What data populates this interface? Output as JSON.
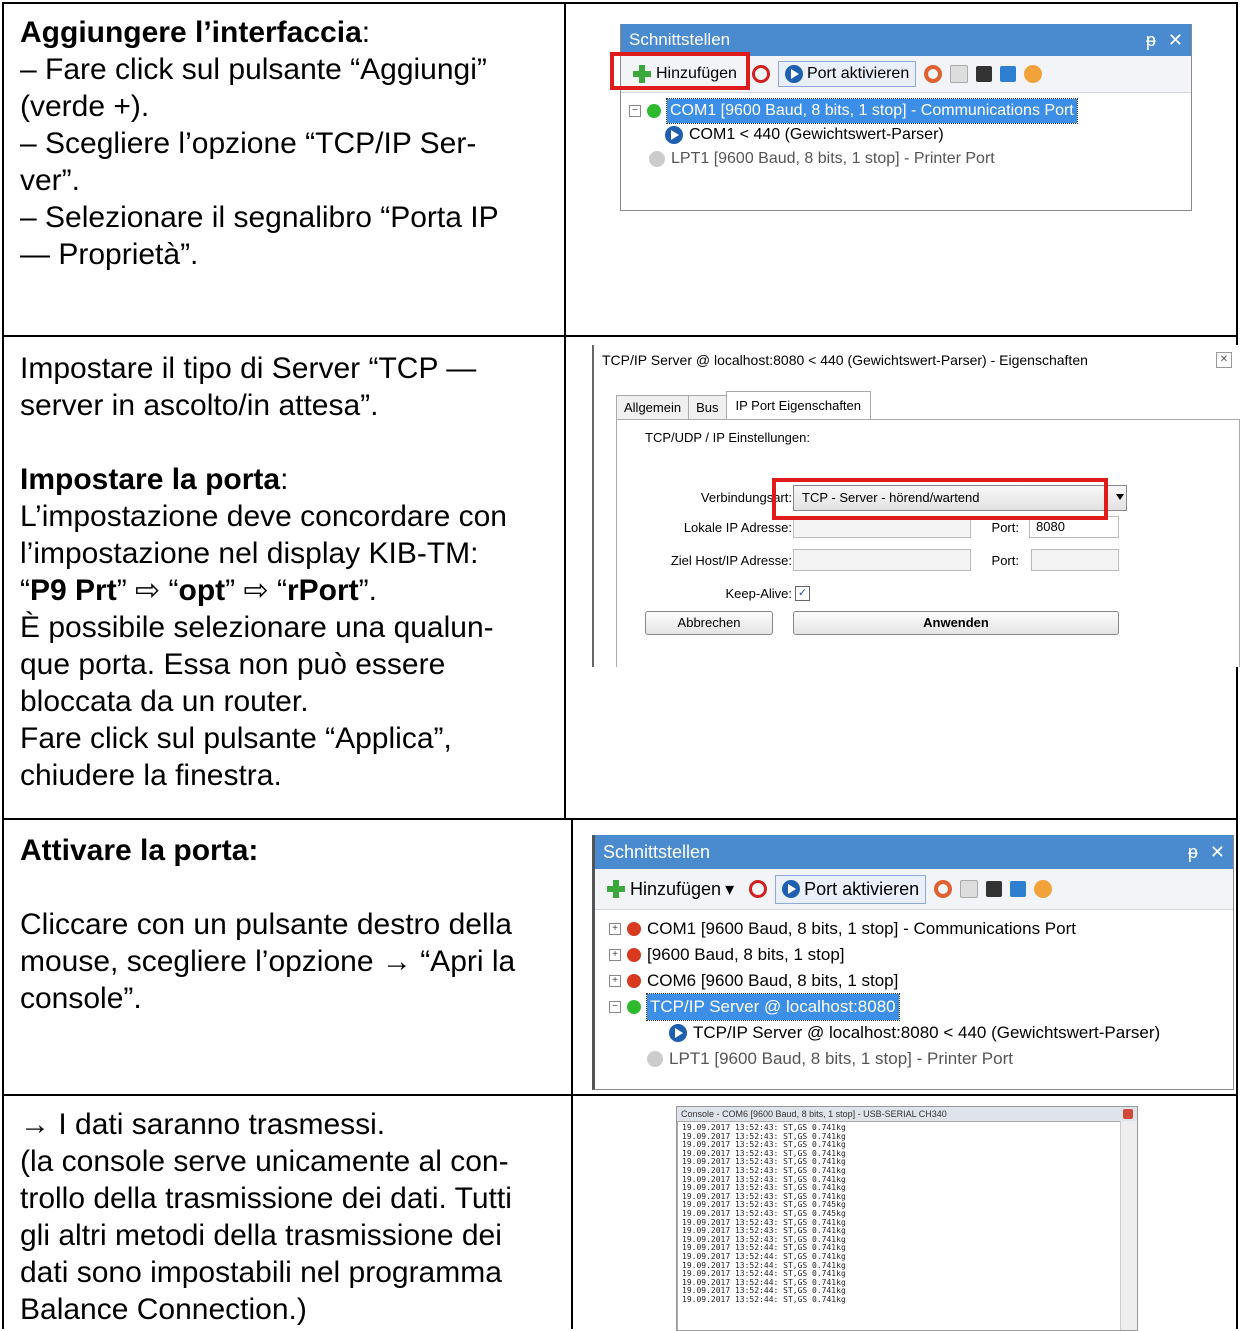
{
  "row1": {
    "heading": "Aggiungere l’interfaccia",
    "heading_suffix": ":",
    "lines": [
      "– Fare click sul pulsante “Aggiungi”",
      "(verde +).",
      "– Scegliere l’opzione “TCP/IP Ser-",
      "ver”.",
      "– Selezionare il segnalibro “Porta IP",
      "— Proprietà”."
    ]
  },
  "row2": {
    "intro_lines": [
      "Impostare il tipo di Server “TCP —",
      "server in ascolto/in attesa”."
    ],
    "heading": "Impostare la porta",
    "heading_suffix": ":",
    "lines_a": [
      "L’impostazione deve concordare con",
      "l’impostazione nel display KIB-TM:"
    ],
    "path": {
      "q1": "“",
      "p1": "P9 Prt",
      "q2": "” ⇨ “",
      "p2": "opt",
      "q3": "” ⇨ “",
      "p3": "rPort",
      "q4": "”."
    },
    "lines_b": [
      "È possibile selezionare una qualun-",
      "que porta. Essa non può essere",
      "bloccata da un router.",
      "Fare click sul pulsante “Applica”,",
      "chiudere la finestra."
    ]
  },
  "row3": {
    "heading": "Attivare la porta:",
    "lines": [
      "Cliccare con un pulsante destro della",
      "mouse, scegliere l’opzione → “Apri la",
      "console”."
    ]
  },
  "row4": {
    "lines": [
      "→ I dati saranno trasmessi.",
      "(la console serve unicamente al con-",
      "trollo della trasmissione dei dati. Tutti",
      "gli altri metodi della trasmissione dei",
      "dati sono impostabili nel programma",
      "Balance Connection.)"
    ]
  },
  "shot1": {
    "title": "Schnittstellen",
    "pin": "ᵽ",
    "close": "✕",
    "add_label": "Hinzufügen",
    "activate_label": "Port aktivieren",
    "tree": [
      "COM1 [9600 Baud, 8 bits, 1 stop] - Communications Port",
      "COM1 < 440 (Gewichtswert-Parser)",
      "LPT1 [9600 Baud, 8 bits, 1 stop] - Printer Port"
    ]
  },
  "shot2": {
    "title": "TCP/IP Server @ localhost:8080 < 440 (Gewichtswert-Parser) - Eigenschaften",
    "close": "✕",
    "tabs": [
      "Allgemein",
      "Bus",
      "IP Port Eigenschaften"
    ],
    "section": "TCP/UDP / IP Einstellungen:",
    "conn_label": "Verbindungsart:",
    "conn_value": "TCP - Server - hörend/wartend",
    "local_ip_label": "Lokale IP Adresse:",
    "port_label": "Port:",
    "port_value": "8080",
    "target_label": "Ziel Host/IP Adresse:",
    "port2_label": "Port:",
    "keepalive_label": "Keep-Alive:",
    "keepalive_check": "✓",
    "cancel": "Abbrechen",
    "apply": "Anwenden"
  },
  "shot3": {
    "title": "Schnittstellen",
    "pin": "ᵽ",
    "close": "✕",
    "add_label": "Hinzufügen",
    "add_arrow": "▾",
    "activate_label": "Port aktivieren",
    "tree": [
      "COM1 [9600 Baud, 8 bits, 1 stop] - Communications Port",
      "[9600 Baud, 8 bits, 1 stop]",
      "COM6 [9600 Baud, 8 bits, 1 stop]",
      "TCP/IP Server @ localhost:8080",
      "TCP/IP Server @ localhost:8080 < 440 (Gewichtswert-Parser)",
      "LPT1 [9600 Baud, 8 bits, 1 stop] - Printer Port"
    ]
  },
  "shot4": {
    "title": "Console - COM6 [9600 Baud, 8 bits, 1 stop] - USB-SERIAL CH340",
    "lines": [
      "19.09.2017 13:52:43: ST,GS 0.741kg",
      "19.09.2017 13:52:43: ST,GS 0.741kg",
      "19.09.2017 13:52:43: ST,GS 0.741kg",
      "19.09.2017 13:52:43: ST,GS 0.741kg",
      "19.09.2017 13:52:43: ST,GS 0.741kg",
      "19.09.2017 13:52:43: ST,GS 0.741kg",
      "19.09.2017 13:52:43: ST,GS 0.741kg",
      "19.09.2017 13:52:43: ST,GS 0.741kg",
      "19.09.2017 13:52:43: ST,GS 0.741kg",
      "19.09.2017 13:52:43: ST,GS 0.745kg",
      "19.09.2017 13:52:43: ST,GS 0.745kg",
      "19.09.2017 13:52:43: ST,GS 0.741kg",
      "19.09.2017 13:52:43: ST,GS 0.741kg",
      "19.09.2017 13:52:43: ST,GS 0.741kg",
      "19.09.2017 13:52:44: ST,GS 0.741kg",
      "19.09.2017 13:52:44: ST,GS 0.741kg",
      "19.09.2017 13:52:44: ST,GS 0.741kg",
      "19.09.2017 13:52:44: ST,GS 0.741kg",
      "19.09.2017 13:52:44: ST,GS 0.741kg",
      "19.09.2017 13:52:44: ST,GS 0.741kg",
      "19.09.2017 13:52:44: ST,GS 0.741kg"
    ]
  }
}
